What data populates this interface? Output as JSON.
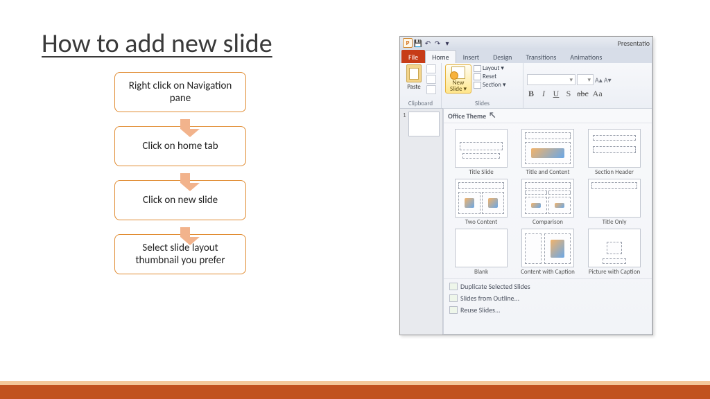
{
  "title": "How to add new slide",
  "steps": [
    "Right click on Navigation pane",
    "Click on home tab",
    "Click on new slide",
    "Select slide layout thumbnail you prefer"
  ],
  "ppt": {
    "app_label": "P",
    "window_title": "Presentatio",
    "tabs": {
      "file": "File",
      "home": "Home",
      "insert": "Insert",
      "design": "Design",
      "transitions": "Transitions",
      "animations": "Animations"
    },
    "ribbon": {
      "paste": "Paste",
      "clipboard": "Clipboard",
      "newslide_l1": "New",
      "newslide_l2": "Slide ▾",
      "layout": "Layout ▾",
      "reset": "Reset",
      "section": "Section ▾",
      "slides": "Slides",
      "font_b": "B",
      "font_i": "I",
      "font_u": "U",
      "font_s": "S",
      "font_abc": "abc",
      "grow": "A▴",
      "shrink": "A▾",
      "aa": "Aa"
    },
    "gallery_header": "Office Theme",
    "layouts": [
      "Title Slide",
      "Title and Content",
      "Section Header",
      "Two Content",
      "Comparison",
      "Title Only",
      "Blank",
      "Content with Caption",
      "Picture with Caption"
    ],
    "footer": {
      "dup": "Duplicate Selected Slides",
      "outline": "Slides from Outline...",
      "reuse": "Reuse Slides..."
    }
  }
}
